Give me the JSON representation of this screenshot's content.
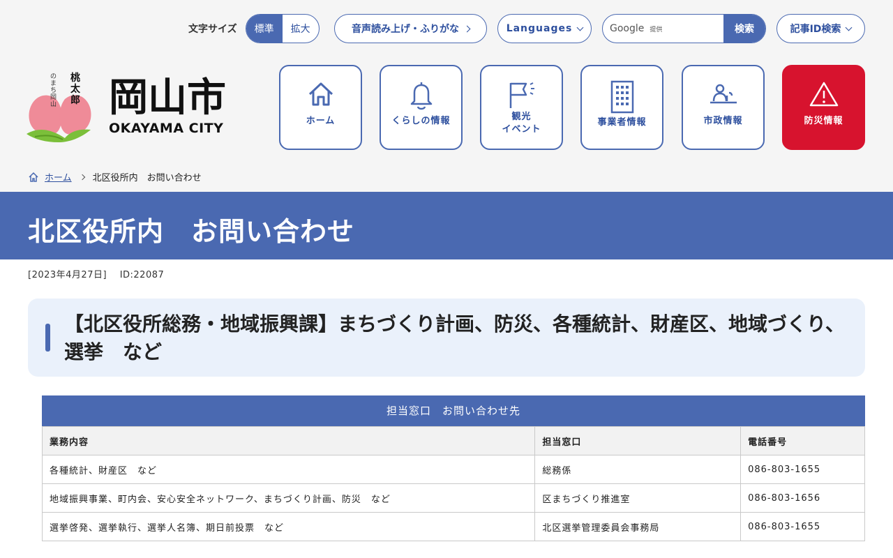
{
  "header": {
    "font_size": {
      "label": "文字サイズ",
      "standard": "標準",
      "large": "拡大"
    },
    "read_aloud": "音声読み上げ・ふりがな",
    "languages": "Languages",
    "search": {
      "provider": "Google",
      "provided_by": "提供",
      "button": "検索"
    },
    "article_id_search": "記事ID検索",
    "logo": {
      "kanji": "岡山市",
      "english": "OKAYAMA CITY",
      "mascot_text": "桃太郎のまち岡山"
    }
  },
  "nav": [
    {
      "label": "ホーム",
      "icon": "home-icon"
    },
    {
      "label": "くらしの情報",
      "icon": "bell-icon"
    },
    {
      "label": "観光\nイベント",
      "icon": "flag-icon"
    },
    {
      "label": "事業者情報",
      "icon": "building-icon"
    },
    {
      "label": "市政情報",
      "icon": "podium-icon"
    },
    {
      "label": "防災情報",
      "icon": "warning-icon"
    }
  ],
  "breadcrumb": {
    "home": "ホーム",
    "current": "北区役所内　お問い合わせ"
  },
  "page": {
    "title": "北区役所内　お問い合わせ",
    "date": "[2023年4月27日]",
    "id": "ID:22087",
    "section_heading": "【北区役所総務・地域振興課】まちづくり計画、防災、各種統計、財産区、地域づくり、選挙　など"
  },
  "table": {
    "caption": "担当窓口　お問い合わせ先",
    "headers": [
      "業務内容",
      "担当窓口",
      "電話番号"
    ],
    "rows": [
      [
        "各種統計、財産区　など",
        "総務係",
        "086-803-1655"
      ],
      [
        "地域振興事業、町内会、安心安全ネットワーク、まちづくり計画、防災　など",
        "区まちづくり推進室",
        "086-803-1656"
      ],
      [
        "選挙啓発、選挙執行、選挙人名簿、期日前投票　など",
        "北区選挙管理委員会事務局",
        "086-803-1655"
      ]
    ]
  },
  "colors": {
    "primary": "#4a69b1",
    "disaster": "#d7132e",
    "heading_bg": "#eaf1fb"
  }
}
